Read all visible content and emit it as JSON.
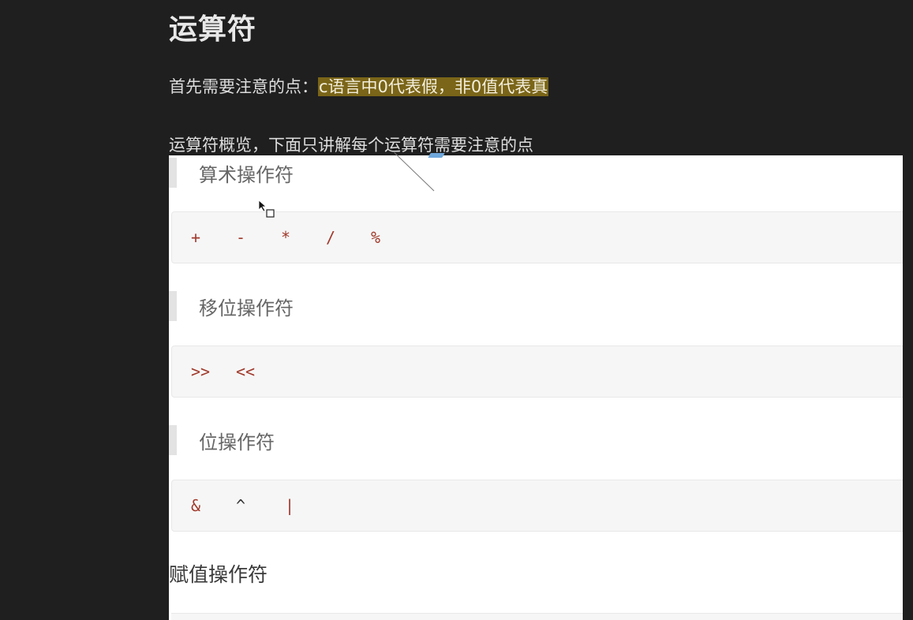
{
  "page": {
    "title": "运算符",
    "note_prefix": "首先需要注意的点：",
    "note_highlight": "c语言中0代表假，非0值代表真",
    "overview_text": "运算符概览，下面只讲解每个运算符需要注意的点"
  },
  "screenshot": {
    "sections": [
      {
        "label": "算术操作符",
        "operators": [
          "+",
          "-",
          "*",
          "/",
          "%"
        ]
      },
      {
        "label": "移位操作符",
        "operators": [
          ">>",
          "<<"
        ]
      },
      {
        "label": "位操作符",
        "operators": [
          "&",
          "^",
          "|"
        ]
      }
    ],
    "assignment_heading": "赋值操作符"
  },
  "colors": {
    "background": "#1f1f1f",
    "highlight": "#7a6518",
    "operator": "#a03a2c"
  },
  "icons": {
    "cursor": "mouse-pointer-icon"
  }
}
